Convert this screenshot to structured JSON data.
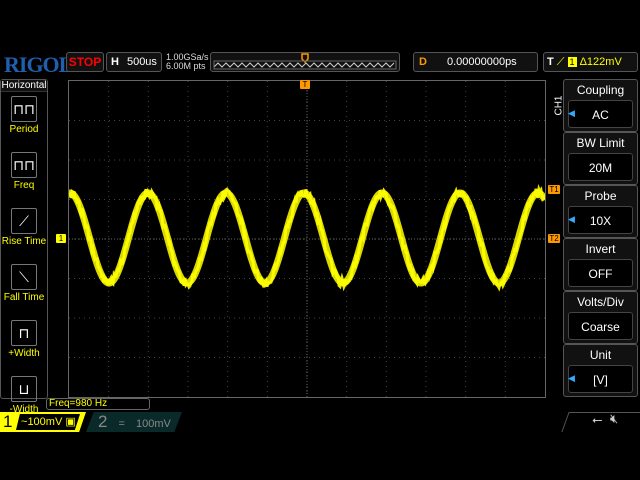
{
  "brand": "RIGOL",
  "run_state": "STOP",
  "horizontal": {
    "label": "H",
    "timebase": "500us",
    "sample_rate": "1.00GSa/s",
    "memory_depth": "6.00M pts"
  },
  "delay": {
    "label": "D",
    "value": "0.00000000ps"
  },
  "trigger": {
    "label": "T",
    "source": "1",
    "level": "Δ122mV",
    "slope_icon": "rising-edge-icon"
  },
  "left_menu": {
    "title": "Horizontal",
    "items": [
      {
        "label": "Period",
        "icon": "period-icon"
      },
      {
        "label": "Freq",
        "icon": "freq-icon"
      },
      {
        "label": "Rise Time",
        "icon": "rise-time-icon"
      },
      {
        "label": "Fall Time",
        "icon": "fall-time-icon"
      },
      {
        "label": "+Width",
        "icon": "plus-width-icon"
      },
      {
        "label": "-Width",
        "icon": "minus-width-icon"
      }
    ]
  },
  "right_menu": {
    "channel": "CH1",
    "items": [
      {
        "title": "Coupling",
        "value": "AC"
      },
      {
        "title": "BW Limit",
        "value": "20M"
      },
      {
        "title": "Probe",
        "value": "10X"
      },
      {
        "title": "Invert",
        "value": "OFF"
      },
      {
        "title": "Volts/Div",
        "value": "Coarse"
      },
      {
        "title": "Unit",
        "value": "[V]"
      }
    ]
  },
  "measurement": "Freq=980 Hz",
  "channels": [
    {
      "num": "1",
      "coupling": "~",
      "scale": "100mV",
      "color": "#ffff00"
    },
    {
      "num": "2",
      "coupling": "=",
      "scale": "100mV",
      "color": "#1a5a5a"
    }
  ],
  "markers": {
    "trigger_pos": "T",
    "ch1": "1",
    "t1": "T1",
    "t2": "T2"
  },
  "colors": {
    "trace": "#ffff00",
    "accent": "#ff9900",
    "stop": "#ff0000"
  }
}
